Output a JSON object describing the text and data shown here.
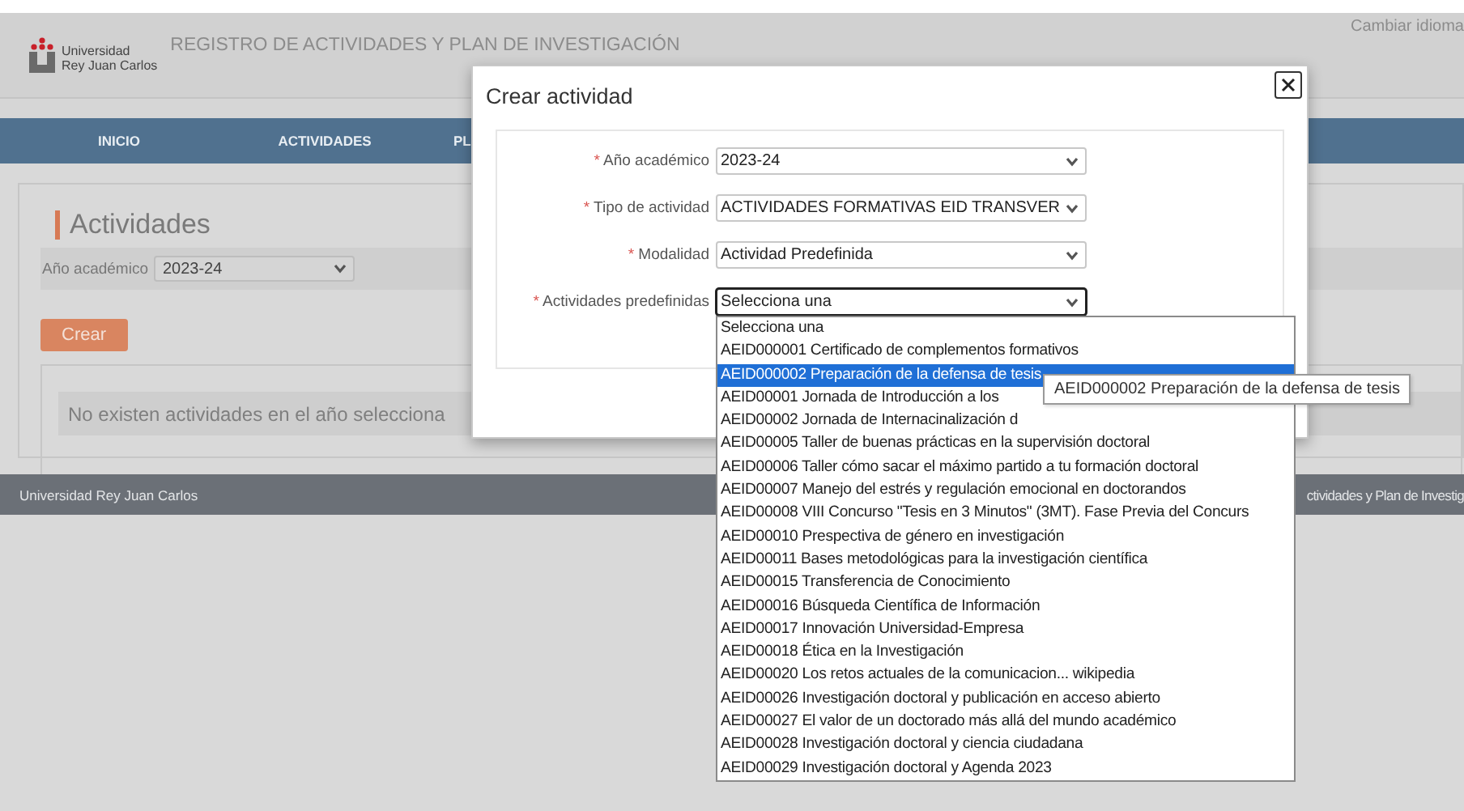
{
  "header": {
    "logo_lines": [
      "Universidad",
      "Rey Juan Carlos"
    ],
    "title": "REGISTRO DE ACTIVIDADES Y PLAN DE INVESTIGACIÓN",
    "language_link": "Cambiar idioma"
  },
  "nav": [
    {
      "label": "INICIO"
    },
    {
      "label": "ACTIVIDADES"
    },
    {
      "label": "PL"
    }
  ],
  "page": {
    "heading": "Actividades",
    "filter": {
      "label": "Año académico",
      "value": "2023-24"
    },
    "create_button": "Crear",
    "empty_message": "No existen actividades en el año selecciona"
  },
  "footer": {
    "left": "Universidad Rey Juan Carlos",
    "right": "ctividades y Plan de Investig"
  },
  "modal": {
    "title": "Crear actividad",
    "fields": [
      {
        "required_mark": "*",
        "label": "Año académico",
        "value": "2023-24",
        "focused": false
      },
      {
        "required_mark": "*",
        "label": "Tipo de actividad",
        "value": "ACTIVIDADES FORMATIVAS EID TRANSVER",
        "focused": false
      },
      {
        "required_mark": "*",
        "label": "Modalidad",
        "value": "Actividad Predefinida",
        "focused": false
      },
      {
        "required_mark": "*",
        "label": "Actividades predefinidas",
        "value": "Selecciona una",
        "focused": true
      }
    ],
    "dropdown": {
      "options": [
        {
          "label": "Selecciona una",
          "selected": false
        },
        {
          "label": "AEID000001 Certificado de complementos formativos",
          "selected": false
        },
        {
          "label": "AEID000002 Preparación de la defensa de tesis",
          "selected": true
        },
        {
          "label": "AEID00001 Jornada de Introducción a los",
          "selected": false
        },
        {
          "label": "AEID00002 Jornada de Internacinalización d",
          "selected": false
        },
        {
          "label": "AEID00005 Taller de buenas prácticas en la supervisión doctoral",
          "selected": false
        },
        {
          "label": "AEID00006 Taller cómo sacar el máximo partido a tu formación doctoral",
          "selected": false
        },
        {
          "label": "AEID00007 Manejo del estrés y regulación emocional en doctorandos",
          "selected": false
        },
        {
          "label": "AEID00008 VIII Concurso \"Tesis en 3 Minutos\" (3MT). Fase Previa del Concurs",
          "selected": false
        },
        {
          "label": "AEID00010 Prespectiva de género en investigación",
          "selected": false
        },
        {
          "label": "AEID00011 Bases metodológicas para la investigación científica",
          "selected": false
        },
        {
          "label": "AEID00015 Transferencia de Conocimiento",
          "selected": false
        },
        {
          "label": "AEID00016 Búsqueda Científica de Información",
          "selected": false
        },
        {
          "label": "AEID00017 Innovación Universidad-Empresa",
          "selected": false
        },
        {
          "label": "AEID00018 Ética en la Investigación",
          "selected": false
        },
        {
          "label": "AEID00020 Los retos actuales de la comunicacion... wikipedia",
          "selected": false
        },
        {
          "label": "AEID00026 Investigación doctoral y publicación en acceso abierto",
          "selected": false
        },
        {
          "label": "AEID00027 El valor de un doctorado más allá del mundo académico",
          "selected": false
        },
        {
          "label": "AEID00028 Investigación doctoral y ciencia ciudadana",
          "selected": false
        },
        {
          "label": "AEID00029 Investigación doctoral y Agenda 2023",
          "selected": false
        }
      ],
      "tooltip": "AEID000002 Preparación de la defensa de tesis"
    }
  }
}
